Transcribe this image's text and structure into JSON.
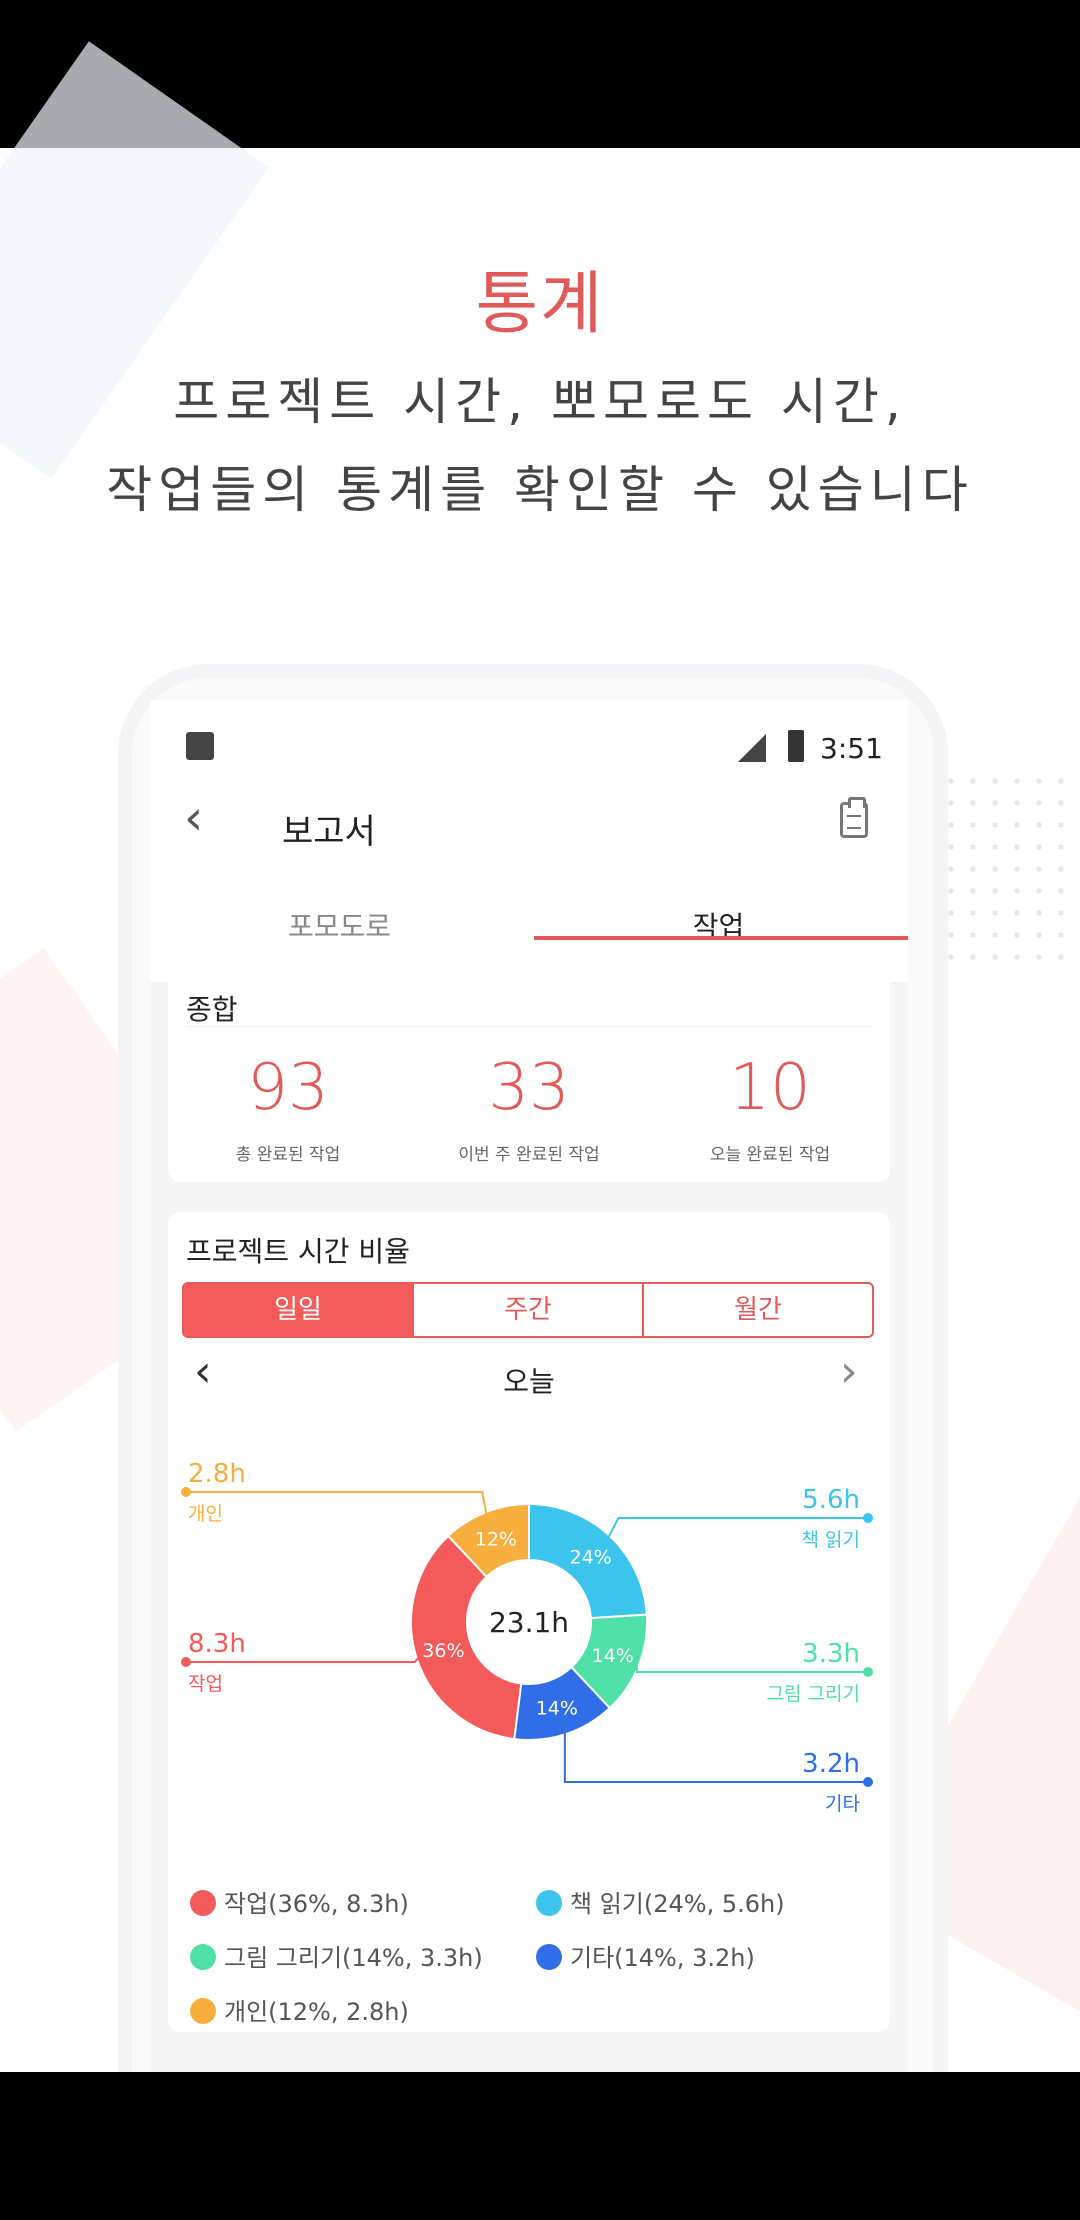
{
  "hero": {
    "title": "통계",
    "line1": "프로젝트 시간, 뽀모로도 시간,",
    "line2": "작업들의 통계를 확인할 수 있습니다"
  },
  "status_bar": {
    "time": "3:51",
    "icons": [
      "app-icon",
      "signal-icon",
      "battery-icon"
    ]
  },
  "app_bar": {
    "back_icon": "chevron-left-icon",
    "title": "보고서",
    "action_icon": "clipboard-icon"
  },
  "tabs": [
    {
      "label": "포모도로",
      "active": false
    },
    {
      "label": "작업",
      "active": true
    }
  ],
  "summary": {
    "title": "종합",
    "stats": [
      {
        "value": "93",
        "label": "총 완료된 작업"
      },
      {
        "value": "33",
        "label": "이번 주 완료된 작업"
      },
      {
        "value": "10",
        "label": "오늘 완료된 작업"
      }
    ]
  },
  "project_time": {
    "title": "프로젝트 시간 비율",
    "segments": [
      "일일",
      "주간",
      "월간"
    ],
    "selected_segment": "일일",
    "date_label": "오늘",
    "total": "23.1h"
  },
  "accent_color": "#e05a5a",
  "chart_data": {
    "type": "pie",
    "center_label": "23.1h",
    "slices": [
      {
        "name": "책 읽기",
        "percent": 24,
        "hours": "5.6h",
        "color": "#3cc4ec",
        "legend": "책 읽기(24%, 5.6h)"
      },
      {
        "name": "그림 그리기",
        "percent": 14,
        "hours": "3.3h",
        "color": "#4ee0a6",
        "legend": "그림 그리기(14%, 3.3h)"
      },
      {
        "name": "기타",
        "percent": 14,
        "hours": "3.2h",
        "color": "#2f6ee6",
        "legend": "기타(14%, 3.2h)"
      },
      {
        "name": "작업",
        "percent": 36,
        "hours": "8.3h",
        "color": "#f35a5a",
        "legend": "작업(36%, 8.3h)"
      },
      {
        "name": "개인",
        "percent": 12,
        "hours": "2.8h",
        "color": "#f8ae3c",
        "legend": "개인(12%, 2.8h)"
      }
    ]
  }
}
